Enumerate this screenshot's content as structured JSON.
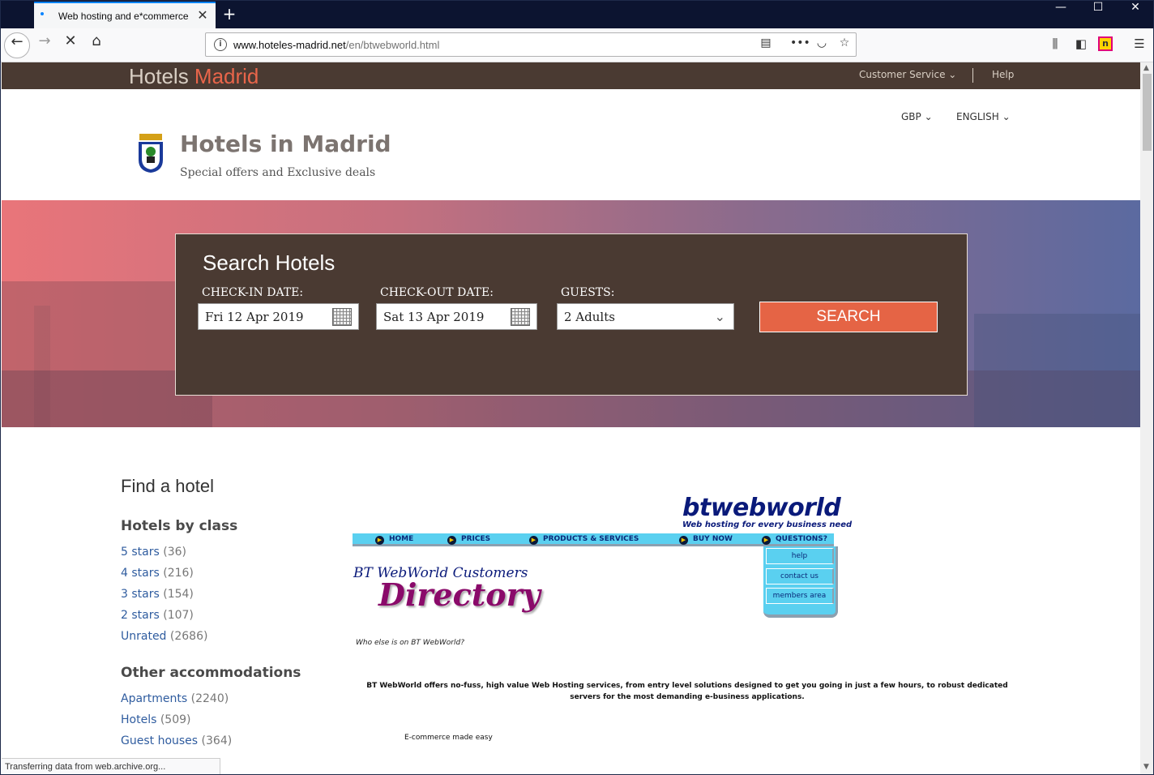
{
  "browser": {
    "tab_title": "Web hosting and e*commerce",
    "tab_close": "✕",
    "new_tab": "+",
    "window_controls": {
      "minimize": "—",
      "maximize": "☐",
      "close": "✕"
    },
    "url_host": "www.hoteles-madrid.net",
    "url_path": "/en/btwebworld.html",
    "status_text": "Transferring data from web.archive.org...",
    "icons": {
      "back": "back-arrow-icon",
      "forward": "forward-arrow-icon",
      "stop": "stop-icon",
      "home": "home-icon",
      "info": "info-icon",
      "reader": "reader-view-icon",
      "more": "more-icon",
      "pocket": "pocket-icon",
      "bookmark": "star-icon",
      "library": "library-icon",
      "sidebar": "sidebar-icon",
      "extension": "extension-icon",
      "menu": "hamburger-menu-icon"
    }
  },
  "site": {
    "brand_main": "Hotels ",
    "brand_accent": "Madrid",
    "customer_service": "Customer Service",
    "help": "Help",
    "currency": "GBP",
    "language": "ENGLISH",
    "title": "Hotels in Madrid",
    "subtitle": "Special offers and Exclusive deals",
    "colors": {
      "accent": "#e56445",
      "brown": "#4a3a32"
    }
  },
  "search": {
    "title": "Search Hotels",
    "checkin_label": "CHECK-IN DATE:",
    "checkin_value": "Fri 12 Apr 2019",
    "checkout_label": "CHECK-OUT DATE:",
    "checkout_value": "Sat 13 Apr 2019",
    "guests_label": "GUESTS:",
    "guests_value": "2 Adults",
    "button": "SEARCH"
  },
  "sidebar": {
    "find_title": "Find a hotel",
    "class_title": "Hotels by class",
    "class_items": [
      {
        "label": "5 stars",
        "count": "(36)"
      },
      {
        "label": "4 stars",
        "count": "(216)"
      },
      {
        "label": "3 stars",
        "count": "(154)"
      },
      {
        "label": "2 stars",
        "count": "(107)"
      },
      {
        "label": "Unrated",
        "count": "(2686)"
      }
    ],
    "other_title": "Other accommodations",
    "other_items": [
      {
        "label": "Apartments",
        "count": "(2240)"
      },
      {
        "label": "Hotels",
        "count": "(509)"
      },
      {
        "label": "Guest houses",
        "count": "(364)"
      }
    ]
  },
  "btwebworld": {
    "logo": "btwebworld",
    "tagline": "Web hosting for every business need",
    "nav": [
      "HOME",
      "PRICES",
      "PRODUCTS & SERVICES",
      "BUY NOW",
      "QUESTIONS?"
    ],
    "dropdown": [
      "help",
      "contact us",
      "members area"
    ],
    "directory_line1": "BT WebWorld Customers",
    "directory_line2": "Directory",
    "who_else": "Who else is on BT WebWorld?",
    "paragraph": "BT WebWorld offers no-fuss, high value Web Hosting services, from entry level solutions designed to get you going in just a few hours, to robust dedicated servers for the most demanding e-business applications.",
    "ecommerce": "E-commerce made easy"
  }
}
